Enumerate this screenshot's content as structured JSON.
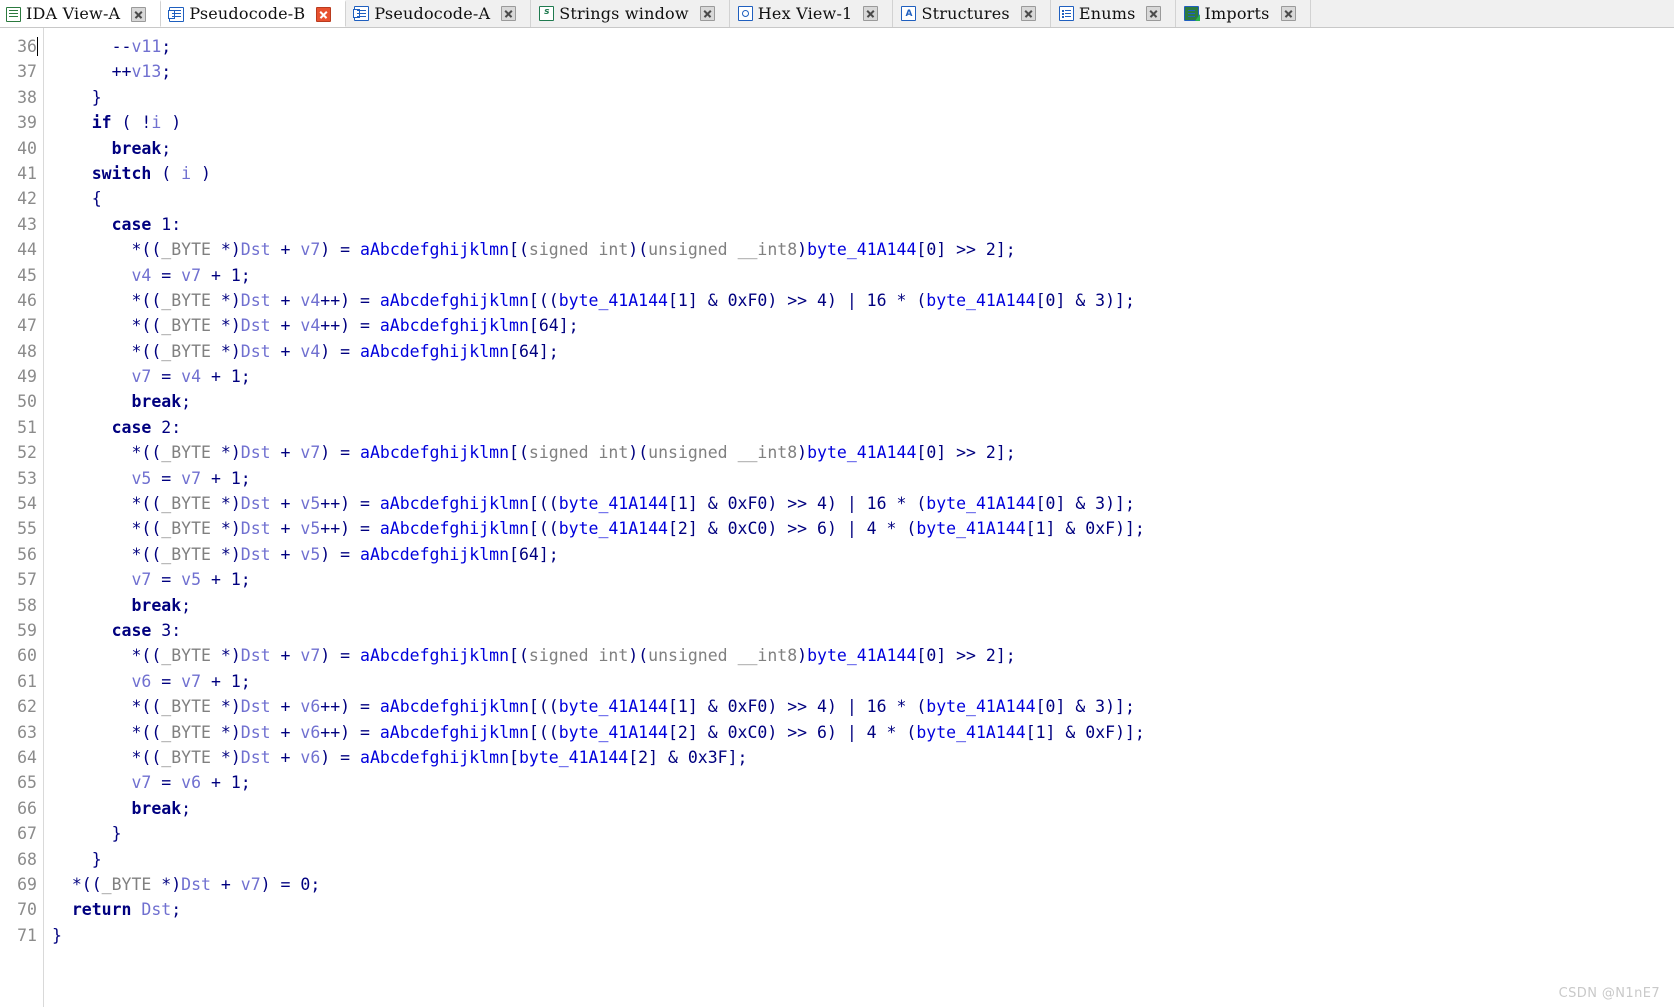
{
  "window": {
    "title": "Pseudocode-B",
    "watermark": "CSDN @N1nE7"
  },
  "tabs": [
    {
      "label": "IDA View-A",
      "icon": "ida-view-icon",
      "active": true,
      "close_style": "gray"
    },
    {
      "label": "Pseudocode-B",
      "icon": "pseudocode-icon",
      "active": true,
      "close_style": "red"
    },
    {
      "label": "Pseudocode-A",
      "icon": "pseudocode-icon",
      "active": false,
      "close_style": "gray"
    },
    {
      "label": "Strings window",
      "icon": "strings-icon",
      "active": false,
      "close_style": "gray"
    },
    {
      "label": "Hex View-1",
      "icon": "hex-view-icon",
      "active": false,
      "close_style": "gray"
    },
    {
      "label": "Structures",
      "icon": "structures-icon",
      "active": false,
      "close_style": "gray"
    },
    {
      "label": "Enums",
      "icon": "enums-icon",
      "active": false,
      "close_style": "gray"
    },
    {
      "label": "Imports",
      "icon": "imports-icon",
      "active": false,
      "close_style": "gray"
    }
  ],
  "colors": {
    "punctuation": "#00007f",
    "keyword": "#00007f",
    "local_variable": "#7070d0",
    "global_symbol": "#0000dd",
    "type_keyword": "#808080",
    "line_number": "#8b8b8b",
    "background": "#ffffff"
  },
  "editor": {
    "first_line": 36,
    "last_line": 71,
    "caret_line": 36,
    "line_numbers": [
      36,
      37,
      38,
      39,
      40,
      41,
      42,
      43,
      44,
      45,
      46,
      47,
      48,
      49,
      50,
      51,
      52,
      53,
      54,
      55,
      56,
      57,
      58,
      59,
      60,
      61,
      62,
      63,
      64,
      65,
      66,
      67,
      68,
      69,
      70,
      71
    ],
    "lines": [
      {
        "n": 36,
        "text": "      --v11;"
      },
      {
        "n": 37,
        "text": "      ++v13;"
      },
      {
        "n": 38,
        "text": "    }"
      },
      {
        "n": 39,
        "text": "    if ( !i )"
      },
      {
        "n": 40,
        "text": "      break;"
      },
      {
        "n": 41,
        "text": "    switch ( i )"
      },
      {
        "n": 42,
        "text": "    {"
      },
      {
        "n": 43,
        "text": "      case 1:"
      },
      {
        "n": 44,
        "text": "        *((_BYTE *)Dst + v7) = aAbcdefghijklmn[(signed int)(unsigned __int8)byte_41A144[0] >> 2];"
      },
      {
        "n": 45,
        "text": "        v4 = v7 + 1;"
      },
      {
        "n": 46,
        "text": "        *((_BYTE *)Dst + v4++) = aAbcdefghijklmn[((byte_41A144[1] & 0xF0) >> 4) | 16 * (byte_41A144[0] & 3)];"
      },
      {
        "n": 47,
        "text": "        *((_BYTE *)Dst + v4++) = aAbcdefghijklmn[64];"
      },
      {
        "n": 48,
        "text": "        *((_BYTE *)Dst + v4) = aAbcdefghijklmn[64];"
      },
      {
        "n": 49,
        "text": "        v7 = v4 + 1;"
      },
      {
        "n": 50,
        "text": "        break;"
      },
      {
        "n": 51,
        "text": "      case 2:"
      },
      {
        "n": 52,
        "text": "        *((_BYTE *)Dst + v7) = aAbcdefghijklmn[(signed int)(unsigned __int8)byte_41A144[0] >> 2];"
      },
      {
        "n": 53,
        "text": "        v5 = v7 + 1;"
      },
      {
        "n": 54,
        "text": "        *((_BYTE *)Dst + v5++) = aAbcdefghijklmn[((byte_41A144[1] & 0xF0) >> 4) | 16 * (byte_41A144[0] & 3)];"
      },
      {
        "n": 55,
        "text": "        *((_BYTE *)Dst + v5++) = aAbcdefghijklmn[((byte_41A144[2] & 0xC0) >> 6) | 4 * (byte_41A144[1] & 0xF)];"
      },
      {
        "n": 56,
        "text": "        *((_BYTE *)Dst + v5) = aAbcdefghijklmn[64];"
      },
      {
        "n": 57,
        "text": "        v7 = v5 + 1;"
      },
      {
        "n": 58,
        "text": "        break;"
      },
      {
        "n": 59,
        "text": "      case 3:"
      },
      {
        "n": 60,
        "text": "        *((_BYTE *)Dst + v7) = aAbcdefghijklmn[(signed int)(unsigned __int8)byte_41A144[0] >> 2];"
      },
      {
        "n": 61,
        "text": "        v6 = v7 + 1;"
      },
      {
        "n": 62,
        "text": "        *((_BYTE *)Dst + v6++) = aAbcdefghijklmn[((byte_41A144[1] & 0xF0) >> 4) | 16 * (byte_41A144[0] & 3)];"
      },
      {
        "n": 63,
        "text": "        *((_BYTE *)Dst + v6++) = aAbcdefghijklmn[((byte_41A144[2] & 0xC0) >> 6) | 4 * (byte_41A144[1] & 0xF)];"
      },
      {
        "n": 64,
        "text": "        *((_BYTE *)Dst + v6) = aAbcdefghijklmn[byte_41A144[2] & 0x3F];"
      },
      {
        "n": 65,
        "text": "        v7 = v6 + 1;"
      },
      {
        "n": 66,
        "text": "        break;"
      },
      {
        "n": 67,
        "text": "      }"
      },
      {
        "n": 68,
        "text": "    }"
      },
      {
        "n": 69,
        "text": "  *((_BYTE *)Dst + v7) = 0;"
      },
      {
        "n": 70,
        "text": "  return Dst;"
      },
      {
        "n": 71,
        "text": "}"
      }
    ]
  },
  "syntax": {
    "keywords": [
      "if",
      "switch",
      "case",
      "break",
      "return"
    ],
    "types": [
      "_BYTE",
      "signed",
      "int",
      "unsigned",
      "__int8"
    ],
    "locals": [
      "v4",
      "v5",
      "v6",
      "v7",
      "v11",
      "v13",
      "i",
      "Dst"
    ],
    "globals": [
      "aAbcdefghijklmn",
      "byte_41A144"
    ]
  }
}
